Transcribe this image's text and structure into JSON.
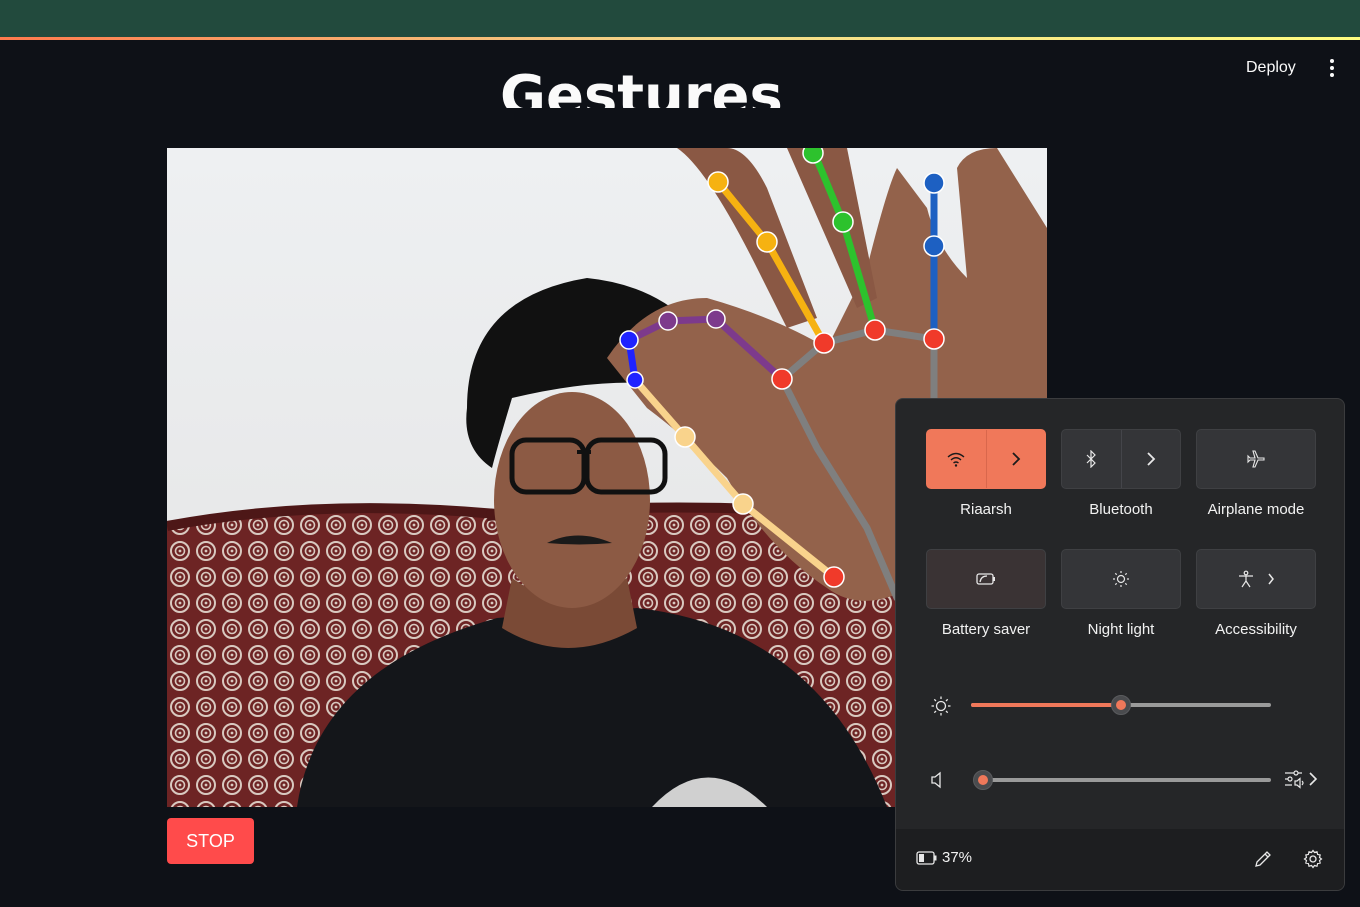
{
  "app": {
    "title_text": "Gestures",
    "deploy_label": "Deploy",
    "stop_label": "STOP"
  },
  "quick_settings": {
    "tiles": [
      {
        "label": "Riaarsh",
        "icon": "wifi-icon",
        "active": true,
        "expandable": true
      },
      {
        "label": "Bluetooth",
        "icon": "bluetooth-icon",
        "active": false,
        "expandable": true
      },
      {
        "label": "Airplane mode",
        "icon": "airplane-icon",
        "active": false,
        "expandable": false
      },
      {
        "label": "Battery saver",
        "icon": "battery-saver-icon",
        "active": false,
        "expandable": false
      },
      {
        "label": "Night light",
        "icon": "night-light-icon",
        "active": false,
        "expandable": false
      },
      {
        "label": "Accessibility",
        "icon": "accessibility-icon",
        "active": false,
        "expandable": true
      }
    ],
    "brightness_level": 0.5,
    "volume_level": 0.0,
    "battery_percent": "37%"
  },
  "colors": {
    "accent": "#f0785a",
    "stop_button": "#ff4b4b",
    "header": "#224a3d",
    "background": "#0e1117"
  }
}
